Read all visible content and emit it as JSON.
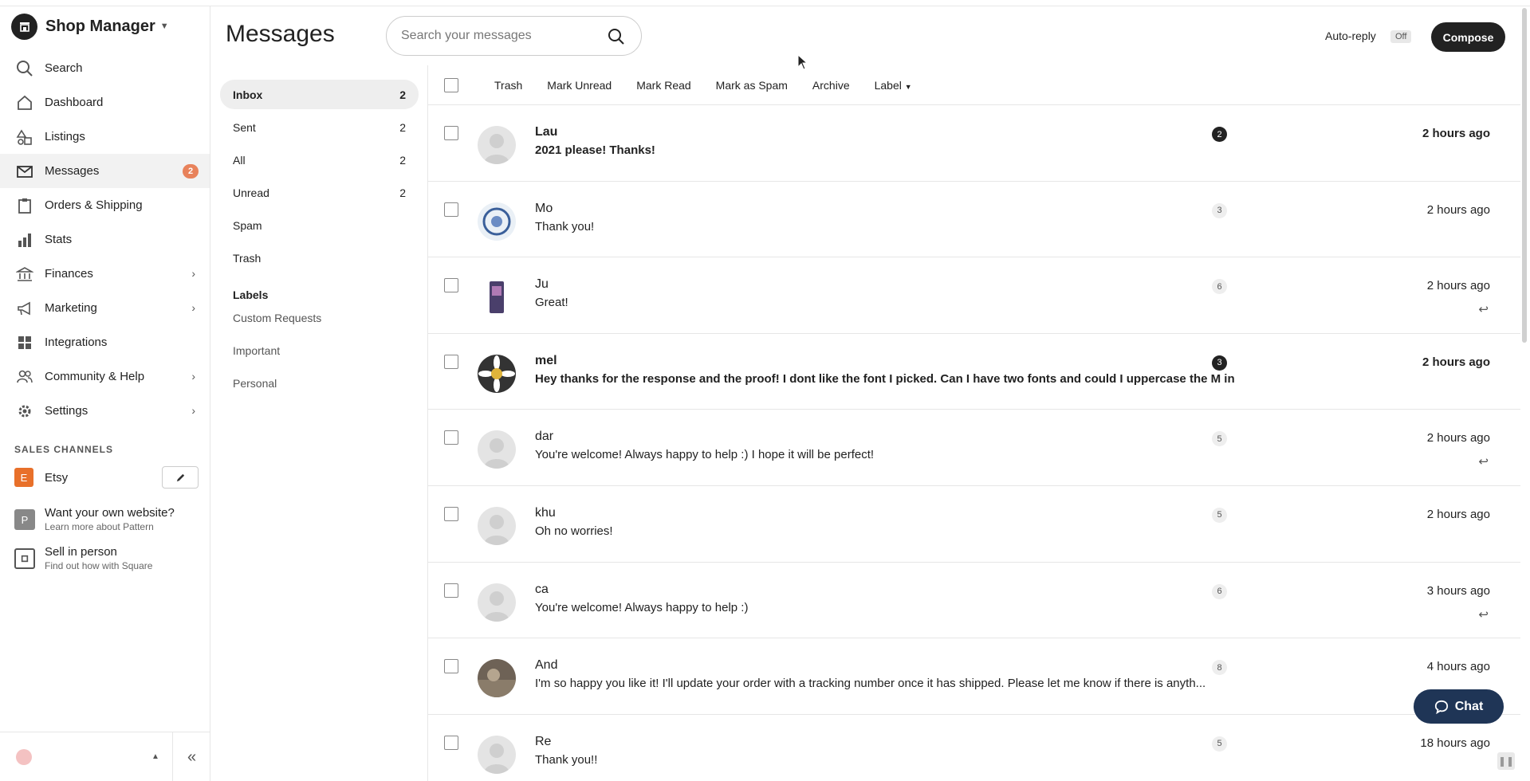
{
  "shop": {
    "title": "Shop Manager"
  },
  "nav": {
    "items": [
      {
        "label": "Search",
        "icon": "search-icon"
      },
      {
        "label": "Dashboard",
        "icon": "home-icon"
      },
      {
        "label": "Listings",
        "icon": "shapes-icon"
      },
      {
        "label": "Messages",
        "icon": "envelope-icon",
        "badge": "2"
      },
      {
        "label": "Orders & Shipping",
        "icon": "clipboard-icon"
      },
      {
        "label": "Stats",
        "icon": "bar-chart-icon"
      },
      {
        "label": "Finances",
        "icon": "bank-icon"
      },
      {
        "label": "Marketing",
        "icon": "megaphone-icon"
      },
      {
        "label": "Integrations",
        "icon": "grid-icon"
      },
      {
        "label": "Community & Help",
        "icon": "people-icon"
      },
      {
        "label": "Settings",
        "icon": "gear-icon"
      }
    ]
  },
  "sales_channels": {
    "title": "SALES CHANNELS",
    "etsy": {
      "badge": "E",
      "name": "Etsy",
      "color": "#e8702a"
    },
    "pattern": {
      "badge": "P",
      "title": "Want your own website?",
      "sub": "Learn more about Pattern"
    },
    "square": {
      "title": "Sell in person",
      "sub": "Find out how with Square"
    }
  },
  "header": {
    "title": "Messages",
    "search_placeholder": "Search your messages",
    "auto_reply_label": "Auto-reply",
    "auto_reply_state": "Off",
    "compose_label": "Compose"
  },
  "folders": [
    {
      "label": "Inbox",
      "count": "2"
    },
    {
      "label": "Sent",
      "count": "2"
    },
    {
      "label": "All",
      "count": "2"
    },
    {
      "label": "Unread",
      "count": "2"
    },
    {
      "label": "Spam",
      "count": ""
    },
    {
      "label": "Trash",
      "count": ""
    }
  ],
  "labels": {
    "title": "Labels",
    "items": [
      "Custom Requests",
      "Important",
      "Personal"
    ]
  },
  "toolbar": {
    "trash": "Trash",
    "mark_unread": "Mark Unread",
    "mark_read": "Mark Read",
    "mark_spam": "Mark as Spam",
    "archive": "Archive",
    "label": "Label"
  },
  "messages": [
    {
      "sender": "Lau",
      "preview": "2021 please! Thanks!",
      "count": "2",
      "time": "2 hours ago"
    },
    {
      "sender": "Mo",
      "preview": "Thank you!",
      "count": "3",
      "time": "2 hours ago"
    },
    {
      "sender": "Ju",
      "preview": "Great!",
      "count": "6",
      "time": "2 hours ago"
    },
    {
      "sender": "mel",
      "preview": "Hey thanks for the response and the proof! I dont like the font I picked. Can I have two fonts and could I uppercase the M in ...",
      "count": "3",
      "time": "2 hours ago"
    },
    {
      "sender": "dar",
      "preview": "You're welcome! Always happy to help :) I hope it will be perfect!",
      "count": "5",
      "time": "2 hours ago"
    },
    {
      "sender": "khu",
      "preview": "Oh no worries!",
      "count": "5",
      "time": "2 hours ago"
    },
    {
      "sender": "ca",
      "preview": "You're welcome! Always happy to help :)",
      "count": "6",
      "time": "3 hours ago"
    },
    {
      "sender": "And",
      "preview": "I'm so happy you like it! I'll update your order with a tracking number once it has shipped. Please let me know if there is anyth...",
      "count": "8",
      "time": "4 hours ago"
    },
    {
      "sender": "Re",
      "preview": "Thank you!!",
      "count": "5",
      "time": "18 hours ago"
    }
  ],
  "chat": {
    "label": "Chat"
  }
}
